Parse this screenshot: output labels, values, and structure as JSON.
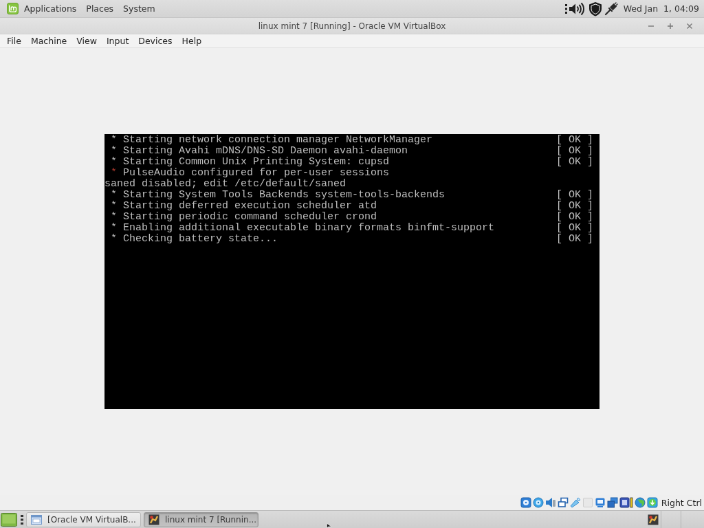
{
  "panel": {
    "menus": [
      "Applications",
      "Places",
      "System"
    ],
    "clock": "Wed Jan  1, 04:09"
  },
  "window": {
    "title": "linux mint 7 [Running] - Oracle VM VirtualBox"
  },
  "menu_bar": [
    "File",
    "Machine",
    "View",
    "Input",
    "Devices",
    "Help"
  ],
  "console": {
    "lines": [
      {
        "kind": "message",
        "bullet": "*",
        "text": "Starting network connection manager NetworkManager",
        "status": "[ OK ]"
      },
      {
        "kind": "message",
        "bullet": "*",
        "text": "Starting Avahi mDNS/DNS-SD Daemon avahi-daemon",
        "status": "[ OK ]"
      },
      {
        "kind": "message",
        "bullet": "*",
        "text": "Starting Common Unix Printing System: cupsd",
        "status": "[ OK ]"
      },
      {
        "kind": "warning",
        "bullet": "*",
        "text": "PulseAudio configured for per-user sessions"
      },
      {
        "kind": "plain",
        "text": "saned disabled; edit /etc/default/saned"
      },
      {
        "kind": "message",
        "bullet": "*",
        "text": "Starting System Tools Backends system-tools-backends",
        "status": "[ OK ]"
      },
      {
        "kind": "message",
        "bullet": "*",
        "text": "Starting deferred execution scheduler atd",
        "status": "[ OK ]"
      },
      {
        "kind": "message",
        "bullet": "*",
        "text": "Starting periodic command scheduler crond",
        "status": "[ OK ]"
      },
      {
        "kind": "message",
        "bullet": "*",
        "text": "Enabling additional executable binary formats binfmt-support",
        "status": "[ OK ]"
      },
      {
        "kind": "message",
        "bullet": "*",
        "text": "Checking battery state...",
        "status": "[ OK ]"
      }
    ]
  },
  "status_bar": {
    "host_key": "Right Ctrl"
  },
  "taskbar": {
    "tasks": [
      {
        "label": "[Oracle VM VirtualB...",
        "selected": false
      },
      {
        "label": "linux mint 7 [Runnin...",
        "selected": true
      }
    ]
  }
}
